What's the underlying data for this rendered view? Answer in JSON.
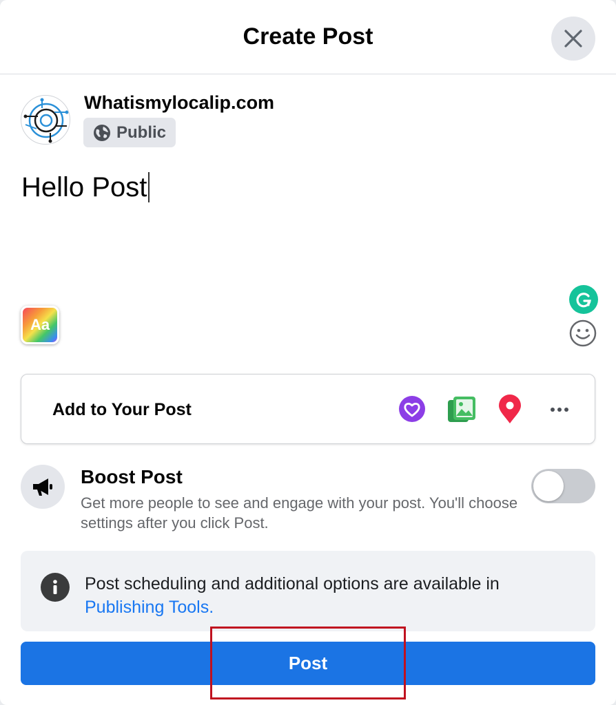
{
  "dialog": {
    "title": "Create Post",
    "close_label": "close"
  },
  "author": {
    "name": "Whatismylocalip.com",
    "privacy": "Public"
  },
  "composer": {
    "text": "Hello Post",
    "format_button": "Aa"
  },
  "add_to_post": {
    "label": "Add to Your Post",
    "icons": [
      "feeling-heart-icon",
      "photo-video-icon",
      "location-pin-icon",
      "more-options-icon"
    ]
  },
  "boost": {
    "title": "Boost Post",
    "description": "Get more people to see and engage with your post. You'll choose settings after you click Post.",
    "enabled": false
  },
  "info": {
    "text": "Post scheduling and additional options are available in ",
    "link": "Publishing Tools."
  },
  "post_button": {
    "label": "Post"
  },
  "colors": {
    "primary": "#1b74e4",
    "link": "#1877f2",
    "highlight": "#c0111f",
    "grammarly": "#15c39a"
  }
}
